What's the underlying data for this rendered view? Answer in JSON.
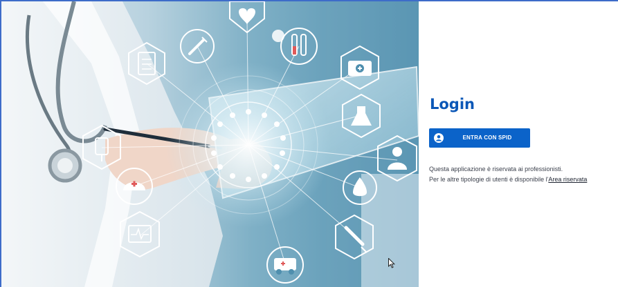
{
  "login": {
    "title": "Login",
    "spid_button_label": "ENTRA CON SPID",
    "info_line_1": "Questa applicazione è riservata ai professionisti.",
    "info_line_2_prefix": "Per le altre tipologie di utenti è disponibile l'",
    "area_link_label": "Area riservata"
  },
  "hero": {
    "icons": [
      "heart-monitor-icon",
      "clipboard-icon",
      "syringe-icon",
      "test-tubes-icon",
      "first-aid-kit-icon",
      "flask-icon",
      "iv-bag-icon",
      "nurse-cap-icon",
      "blood-drop-icon",
      "doctor-icon",
      "ecg-monitor-icon",
      "injection-icon",
      "ambulance-icon"
    ]
  },
  "colors": {
    "accent": "#0b57b7",
    "button": "#0b63c9",
    "frame_border": "#3d6cc9",
    "text": "#3a3f4b"
  }
}
